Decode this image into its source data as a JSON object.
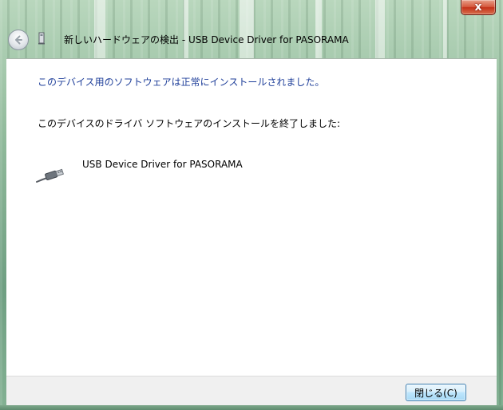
{
  "window": {
    "close_glyph": "x"
  },
  "wizard": {
    "back_icon": "back-arrow-icon",
    "app_icon": "device-installer-icon",
    "title": "新しいハードウェアの検出 - USB Device Driver for PASORAMA"
  },
  "content": {
    "success_message": "このデバイス用のソフトウェアは正常にインストールされました。",
    "completion_message": "このデバイスのドライバ ソフトウェアのインストールを終了しました:",
    "device_icon": "usb-cable-icon",
    "device_name": "USB Device Driver for PASORAMA"
  },
  "footer": {
    "close_button_label": "閉じる(C)"
  },
  "colors": {
    "heading_blue": "#1f3f9a",
    "close_red": "#c43218",
    "button_border": "#3c7fb1"
  }
}
